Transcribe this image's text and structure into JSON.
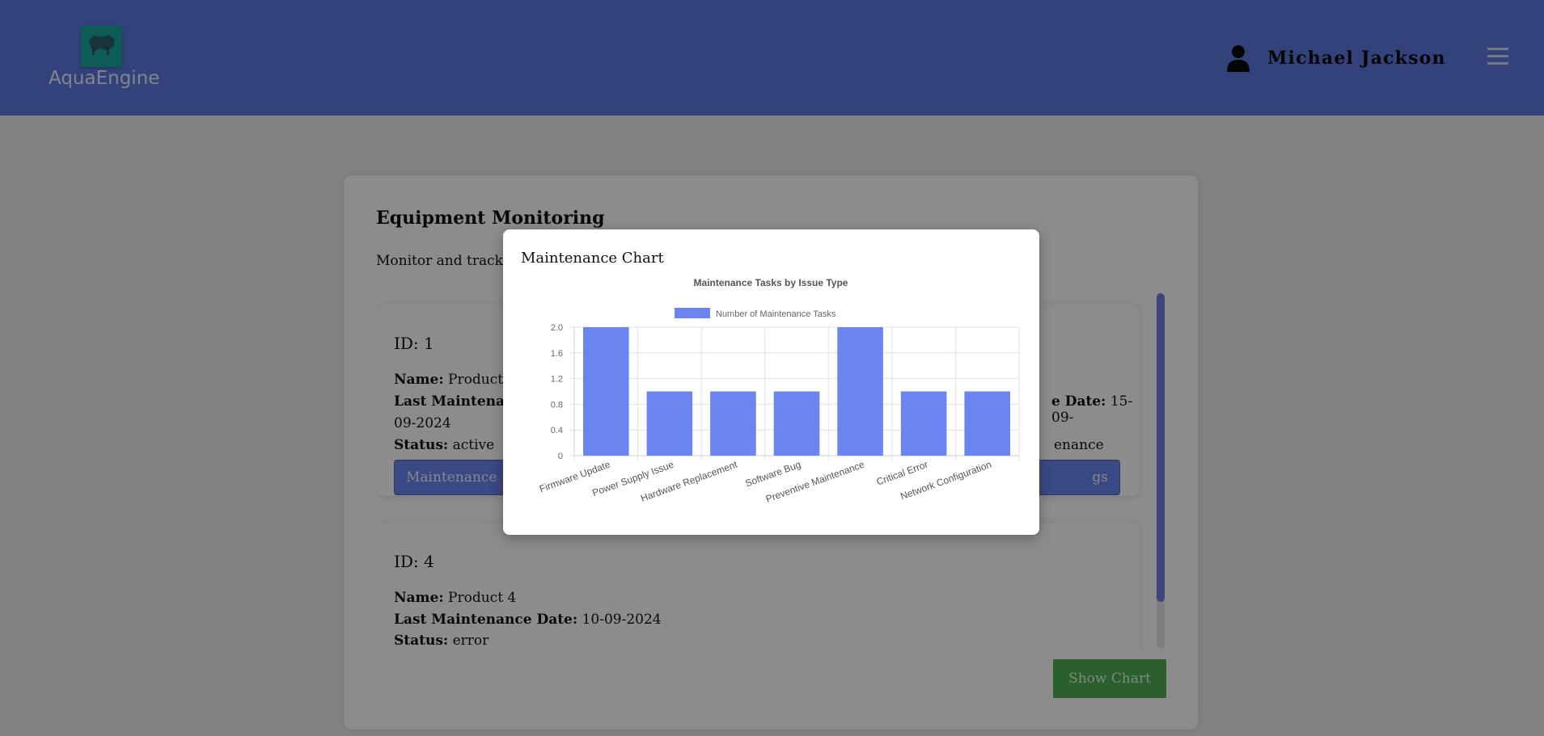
{
  "header": {
    "logo_text": "AquaEngine",
    "user_name": "Michael Jackson",
    "background_color": "#5d78e0"
  },
  "card": {
    "title": "Equipment Monitoring",
    "subtitle": "Monitor and track e",
    "items": [
      {
        "id_label": "ID: 1",
        "name_label": "Name:",
        "name_value": "Product",
        "last_maint_label": "Last Maintenanc",
        "last_maint_continued": "09-2024",
        "right_date_label": "e Date:",
        "right_date_value": "15-09-",
        "status_label": "Status:",
        "status_value": "active",
        "right_status_text": "enance",
        "button_label": "Maintenance",
        "right_button_label": "gs"
      },
      {
        "id_label": "ID: 4",
        "name_label": "Name:",
        "name_value": "Product 4",
        "last_maint_label": "Last Maintenance Date:",
        "last_maint_value": "10-09-2024",
        "status_label": "Status:",
        "status_value": "error"
      }
    ],
    "show_chart_button": "Show Chart"
  },
  "modal": {
    "title": "Maintenance Chart"
  },
  "chart_data": {
    "type": "bar",
    "title": "Maintenance Tasks by Issue Type",
    "categories": [
      "Firmware Update",
      "Power Supply Issue",
      "Hardware Replacement",
      "Software Bug",
      "Preventive Maintenance",
      "Critical Error",
      "Network Configuration"
    ],
    "series": [
      {
        "name": "Number of Maintenance Tasks",
        "values": [
          2,
          1,
          1,
          1,
          2,
          1,
          1
        ],
        "color": "#6a84f0"
      }
    ],
    "ylim": [
      0,
      2
    ],
    "yticks": [
      "0",
      "0.4",
      "0.8",
      "1.2",
      "1.6",
      "2.0"
    ],
    "ytick_values": [
      0,
      0.4,
      0.8,
      1.2,
      1.6,
      2.0
    ],
    "grid": true,
    "legend_position": "top"
  }
}
